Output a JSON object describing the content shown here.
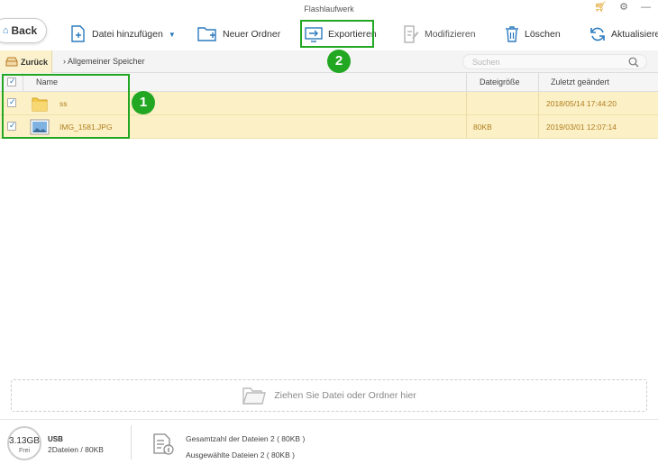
{
  "window": {
    "title": "Flashlaufwerk"
  },
  "toolbar": {
    "back_label": "Back",
    "add_files_label": "Datei hinzufügen",
    "new_folder_label": "Neuer Ordner",
    "export_label": "Exportieren",
    "modify_label": "Modifizieren",
    "delete_label": "Löschen",
    "refresh_label": "Aktualisieren"
  },
  "pathbar": {
    "back_label": "Zurück",
    "breadcrumb": "Allgemeiner Speicher",
    "search_placeholder": "Suchen"
  },
  "table": {
    "columns": {
      "name": "Name",
      "size": "Dateigröße",
      "modified": "Zuletzt geändert"
    },
    "rows": [
      {
        "name": "ss",
        "size": "",
        "modified": "2018/05/14 17:44:20",
        "checked": true,
        "icon": "folder-icon"
      },
      {
        "name": "IMG_1581.JPG",
        "size": "80KB",
        "modified": "2019/03/01 12:07:14",
        "checked": true,
        "icon": "image-file-icon"
      }
    ]
  },
  "annotations": {
    "step1": "1",
    "step2": "2"
  },
  "dropzone": {
    "label": "Ziehen Sie Datei oder Ordner hier"
  },
  "status": {
    "free_size": "3.13GB",
    "free_label": "Frei",
    "device_name": "USB",
    "device_info": "2Dateien / 80KB",
    "total_files": "Gesamtzahl der Dateien 2 ( 80KB )",
    "selected_files": "Ausgewählte Dateien 2 ( 80KB )"
  },
  "colors": {
    "accent": "#2a7abf",
    "selection_row": "#fbf0c6",
    "annotation": "#22a722",
    "row_text": "#b07d1e"
  }
}
